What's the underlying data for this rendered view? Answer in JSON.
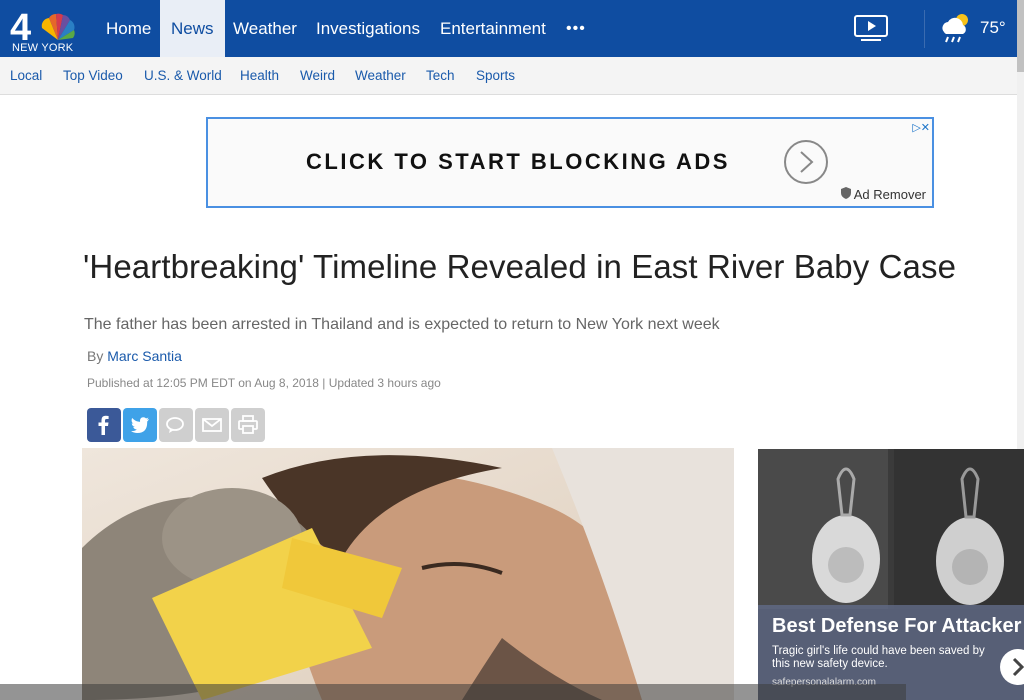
{
  "brand": {
    "logo_number": "4",
    "logo_caption": "NEW YORK"
  },
  "nav": {
    "items": [
      {
        "label": "Home",
        "active": false
      },
      {
        "label": "News",
        "active": true
      },
      {
        "label": "Weather",
        "active": false
      },
      {
        "label": "Investigations",
        "active": false
      },
      {
        "label": "Entertainment",
        "active": false
      }
    ],
    "more_label": "•••",
    "video_icon": "play-video-icon",
    "weather_icon": "partly-cloudy-rain-icon",
    "temperature": "75°"
  },
  "subnav": {
    "items": [
      "Local",
      "Top Video",
      "U.S. & World",
      "Health",
      "Weird",
      "Weather",
      "Tech",
      "Sports"
    ]
  },
  "ad": {
    "text": "CLICK TO START BLOCKING ADS",
    "remover": "Ad Remover",
    "badge": "▷✕",
    "arrow_icon": "chevron-right-circle-icon"
  },
  "article": {
    "headline": "'Heartbreaking' Timeline Revealed in East River Baby Case",
    "dek": "The father has been arrested in Thailand and is expected to return to New York next week",
    "byline_prefix": "By",
    "author": "Marc Santia",
    "dateline": "Published at 12:05 PM EDT on Aug 8, 2018 | Updated 3 hours ago"
  },
  "share": [
    {
      "name": "facebook",
      "color": "#3b5998"
    },
    {
      "name": "twitter",
      "color": "#3fa2e8"
    },
    {
      "name": "comment",
      "color": "#cfcfcf"
    },
    {
      "name": "email",
      "color": "#cfcfcf"
    },
    {
      "name": "print",
      "color": "#cfcfcf"
    }
  ],
  "promo": {
    "title": "Best Defense For Attacker",
    "description": "Tragic girl's life could have been saved by this new safety device.",
    "url": "safepersonalalarm.com"
  },
  "colors": {
    "brand_blue": "#0f4da1",
    "link_blue": "#1a5aab"
  }
}
